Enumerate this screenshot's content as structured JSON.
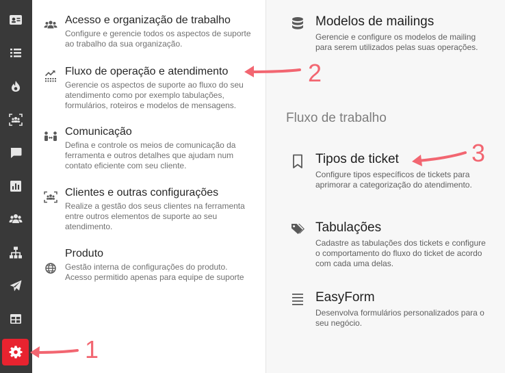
{
  "rail": {
    "items": [
      {
        "icon": "contact-card-icon"
      },
      {
        "icon": "list-icon"
      },
      {
        "icon": "flame-icon"
      },
      {
        "icon": "group-focus-icon"
      },
      {
        "icon": "chat-icon"
      },
      {
        "icon": "bar-chart-icon"
      },
      {
        "icon": "users-icon"
      },
      {
        "icon": "sitemap-icon"
      },
      {
        "icon": "send-icon"
      },
      {
        "icon": "table-icon"
      },
      {
        "icon": "gear-icon",
        "active": true
      }
    ],
    "active_color": "#e8232f"
  },
  "menu": {
    "items": [
      {
        "title": "Acesso e organização de trabalho",
        "desc": "Configure e gerencie todos os aspectos de suporte ao trabalho da sua organização.",
        "icon": "users-icon"
      },
      {
        "title": "Fluxo de operação e atendimento",
        "desc": "Gerencie os aspectos de suporte ao fluxo do seu atendimento como por exemplo tabulações, formulários, roteiros e modelos de mensagens.",
        "icon": "flow-chart-icon"
      },
      {
        "title": "Comunicação",
        "desc": "Defina e controle os meios de comunicação da ferramenta e outros detalhes que ajudam num contato eficiente com seu cliente.",
        "icon": "communication-icon"
      },
      {
        "title": "Clientes e outras configurações",
        "desc": "Realize a gestão dos seus clientes na ferramenta entre outros elementos de suporte ao seu atendimento.",
        "icon": "group-focus-icon"
      },
      {
        "title": "Produto",
        "desc": "Gestão interna de configurações do produto. Acesso permitido apenas para equipe de suporte",
        "icon": "globe-icon"
      }
    ]
  },
  "content": {
    "top_item": {
      "title": "Modelos de mailings",
      "desc": "Gerencie e configure os modelos de mailing para serem utilizados pelas suas operações.",
      "icon": "database-icon"
    },
    "section_title": "Fluxo de trabalho",
    "items": [
      {
        "title": "Tipos de ticket",
        "desc": "Configure tipos específicos de tickets para aprimorar a categorização do atendimento.",
        "icon": "bookmark-icon"
      },
      {
        "title": "Tabulações",
        "desc": "Cadastre as tabulações dos tickets e configure o comportamento do fluxo do ticket de acordo com cada uma delas.",
        "icon": "tags-icon"
      },
      {
        "title": "EasyForm",
        "desc": "Desenvolva formulários personalizados para o seu negócio.",
        "icon": "lines-icon"
      }
    ]
  },
  "annotations": {
    "color": "#f26671",
    "labels": [
      "1",
      "2",
      "3"
    ]
  }
}
